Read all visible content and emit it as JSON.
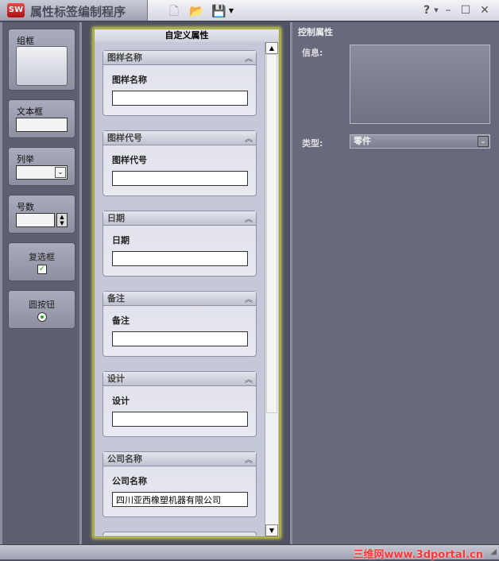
{
  "app": {
    "title": "属性标签编制程序",
    "logo": "SW"
  },
  "toolbar": {
    "icons": [
      "new-file-icon",
      "open-folder-icon",
      "save-icon"
    ],
    "help": "?"
  },
  "toolbox": {
    "items": [
      {
        "label": "组框"
      },
      {
        "label": "文本框"
      },
      {
        "label": "列举"
      },
      {
        "label": "号数"
      },
      {
        "label": "复选框"
      },
      {
        "label": "圆按钮"
      }
    ]
  },
  "sheet": {
    "title": "自定义属性",
    "groups": [
      {
        "title": "图样名称",
        "label": "图样名称",
        "value": ""
      },
      {
        "title": "图样代号",
        "label": "图样代号",
        "value": ""
      },
      {
        "title": "日期",
        "label": "日期",
        "value": ""
      },
      {
        "title": "备注",
        "label": "备注",
        "value": ""
      },
      {
        "title": "设计",
        "label": "设计",
        "value": ""
      },
      {
        "title": "公司名称",
        "label": "公司名称",
        "value": "四川亚西橡塑机器有限公司"
      }
    ]
  },
  "control": {
    "title": "控制属性",
    "info_label": "信息:",
    "type_label": "类型:",
    "type_value": "零件"
  },
  "status": {
    "watermark": "三维网www.3dportal.cn"
  }
}
